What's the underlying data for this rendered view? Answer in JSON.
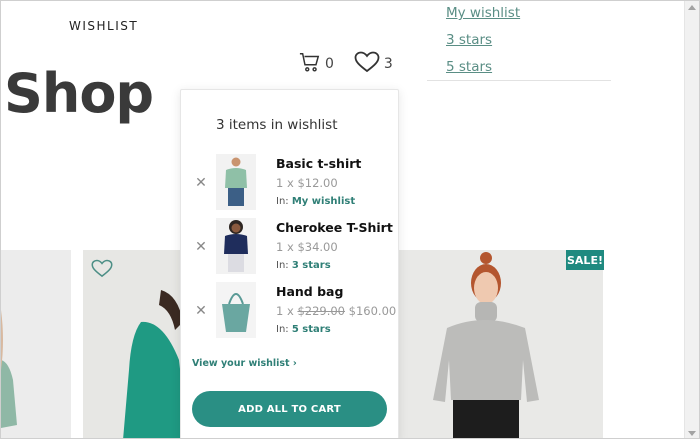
{
  "header": {
    "brand": "WISHLIST",
    "title": "Shop",
    "cart_count": "0",
    "wishlist_count": "3"
  },
  "top_menu": {
    "items": [
      "My wishlist",
      "3 stars",
      "5 stars"
    ]
  },
  "dropdown": {
    "heading": "3 items in wishlist",
    "remove_glyph": "✕",
    "in_label": "In:",
    "items": [
      {
        "name": "Basic t-shirt",
        "qty": "1 x",
        "price": "$12.00",
        "old_price": "",
        "list": "My wishlist"
      },
      {
        "name": "Cherokee T-Shirt",
        "qty": "1 x",
        "price": "$34.00",
        "old_price": "",
        "list": "3 stars"
      },
      {
        "name": "Hand bag",
        "qty": "1 x",
        "price": "$160.00",
        "old_price": "$229.00",
        "list": "5 stars"
      }
    ],
    "view_link": "View your wishlist ›",
    "add_all_button": "ADD ALL TO CART"
  },
  "products": {
    "sale_badge": "SALE!"
  },
  "colors": {
    "accent": "#2a8f84",
    "link": "#5a8e85"
  },
  "icons": {
    "cart": "cart-icon",
    "heart": "heart-icon",
    "remove": "close-icon"
  }
}
